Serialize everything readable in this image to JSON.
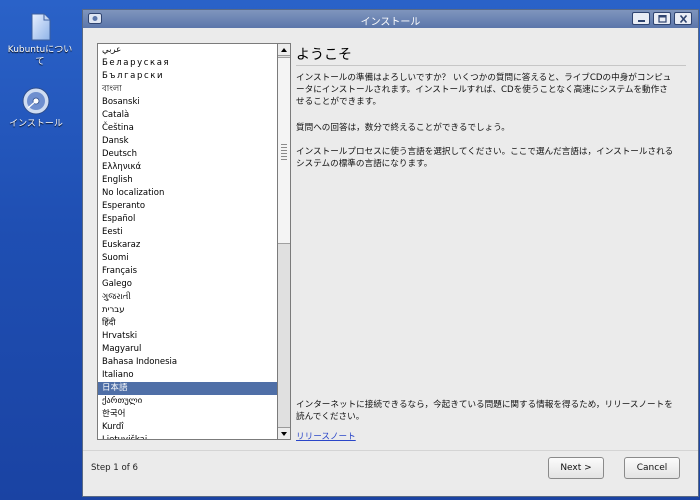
{
  "desktop": {
    "icons": [
      {
        "name": "kubuntu-about",
        "label": "Kubuntuについて"
      },
      {
        "name": "install",
        "label": "インストール"
      }
    ]
  },
  "window": {
    "title": "インストール",
    "heading": "ようこそ",
    "paragraphs": [
      "インストールの準備はよろしいですか？ いくつかの質問に答えると、ライブCDの中身がコンピュータにインストールされます。インストールすれば、CDを使うことなく高速にシステムを動作させることができます。",
      "質問への回答は，数分で終えることができるでしょう。",
      "インストールプロセスに使う言語を選択してください。ここで選んだ言語は，インストールされるシステムの標準の言語になります。",
      "インターネットに接続できるなら，今起きている問題に関する情報を得るため，リリースノートを読んでください。"
    ],
    "release_notes_link": "リリースノート",
    "step_text": "Step 1 of 6",
    "next_button": "Next >",
    "cancel_button": "Cancel"
  },
  "languages": {
    "selected_index": 26,
    "items": [
      "عربي",
      "Беларуская",
      "Български",
      "বাংলা",
      "Bosanski",
      "Català",
      "Čeština",
      "Dansk",
      "Deutsch",
      "Ελληνικά",
      "English",
      "No localization",
      "Esperanto",
      "Español",
      "Eesti",
      "Euskaraz",
      "Suomi",
      "Français",
      "Galego",
      "ગુજરાતી",
      "עברית",
      "हिंदी",
      "Hrvatski",
      "Magyarul",
      "Bahasa Indonesia",
      "Italiano",
      "日本語",
      "ქართული",
      "한국어",
      "Kurdî",
      "Lietuviškai"
    ]
  },
  "colors": {
    "selection": "#4f6fa7",
    "titlebar": "#5b76aa",
    "desktop": "#1f4fb3",
    "link": "#2a46c8"
  }
}
